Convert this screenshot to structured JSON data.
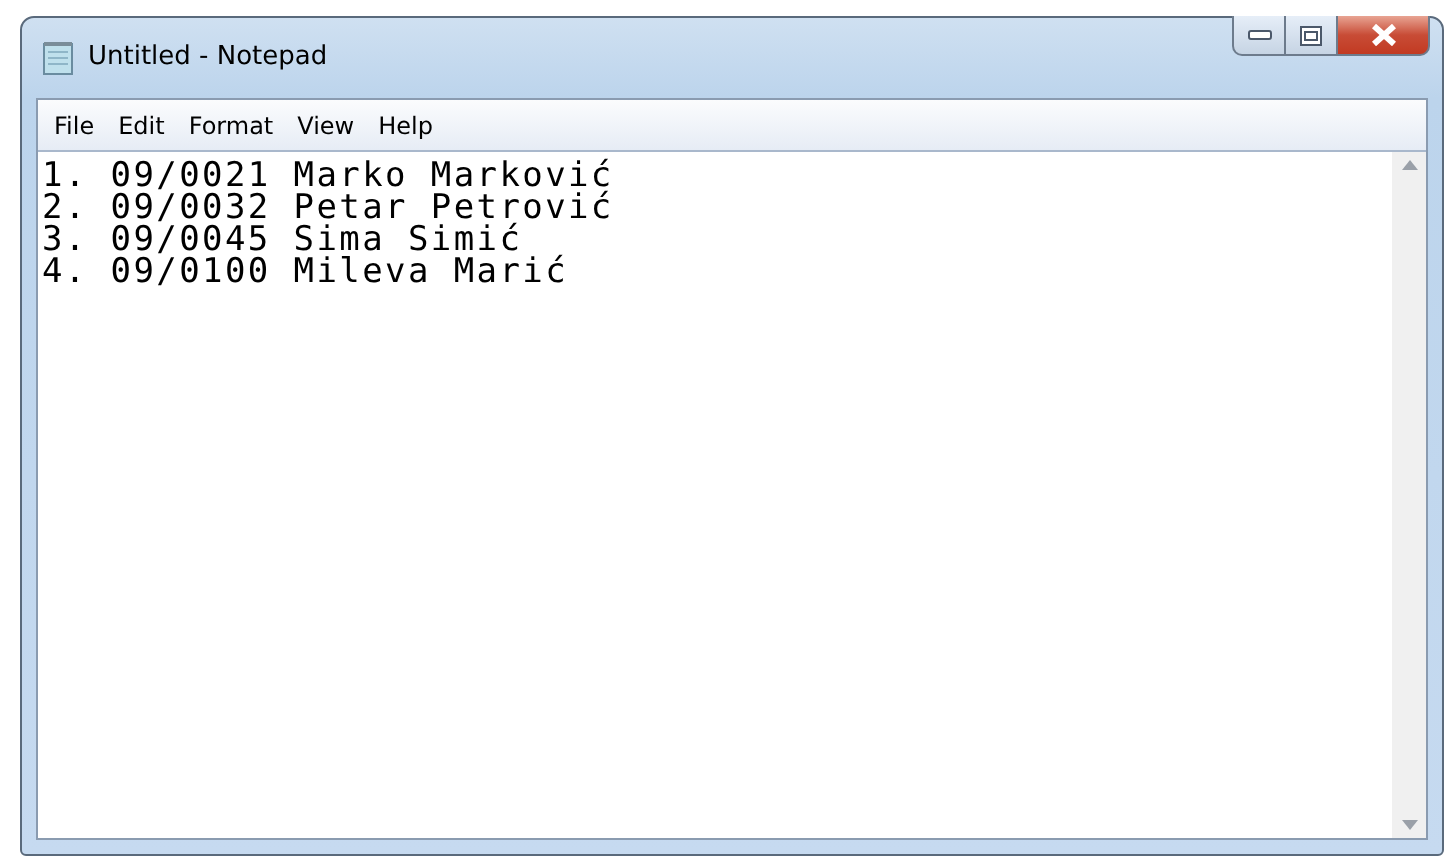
{
  "window": {
    "title": "Untitled - Notepad"
  },
  "menu": [
    "File",
    "Edit",
    "Format",
    "View",
    "Help"
  ],
  "document": {
    "lines": [
      "1. 09/0021 Marko Marković",
      "2. 09/0032 Petar Petrović",
      "3. 09/0045 Sima Simić",
      "4. 09/0100 Mileva Marić"
    ]
  }
}
